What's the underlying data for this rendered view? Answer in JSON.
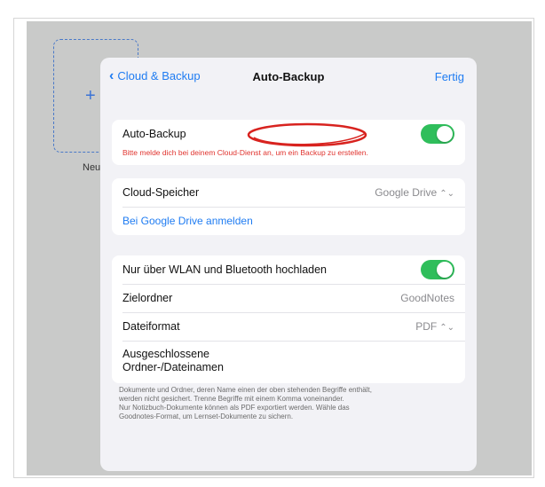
{
  "background": {
    "new_tile_label": "Neu",
    "accent": "#3a73d6"
  },
  "nav": {
    "back_label": "Cloud & Backup",
    "title": "Auto-Backup",
    "done_label": "Fertig"
  },
  "group1": {
    "auto_backup_label": "Auto-Backup",
    "auto_backup_on": true,
    "error_message": "Bitte melde dich bei deinem Cloud-Dienst an, um ein Backup zu erstellen."
  },
  "group2": {
    "cloud_storage_label": "Cloud-Speicher",
    "cloud_storage_value": "Google Drive",
    "sign_in_link": "Bei Google Drive anmelden"
  },
  "group3": {
    "wifi_only_label": "Nur über WLAN und Bluetooth hochladen",
    "wifi_only_on": true,
    "target_folder_label": "Zielordner",
    "target_folder_value": "GoodNotes",
    "file_format_label": "Dateiformat",
    "file_format_value": "PDF",
    "excluded_line1": "Ausgeschlossene",
    "excluded_line2": "Ordner-/Dateinamen"
  },
  "footnote": {
    "line1": "Dokumente und Ordner, deren Name einen der oben stehenden Begriffe enthält,",
    "line2": "werden nicht gesichert. Trenne Begriffe mit einem Komma voneinander.",
    "line3": "Nur Notizbuch-Dokumente können als PDF exportiert werden. Wähle das",
    "line4": "Goodnotes-Format, um Lernset-Dokumente zu sichern."
  },
  "colors": {
    "accent_blue": "#1f7cf2",
    "toggle_green": "#2fbe5b",
    "error_red": "#e0342f",
    "annotation_red": "#d8231f"
  },
  "icons": {
    "back": "chevron-left-icon",
    "stepper": "up-down-chevron-icon",
    "add": "plus-icon"
  }
}
